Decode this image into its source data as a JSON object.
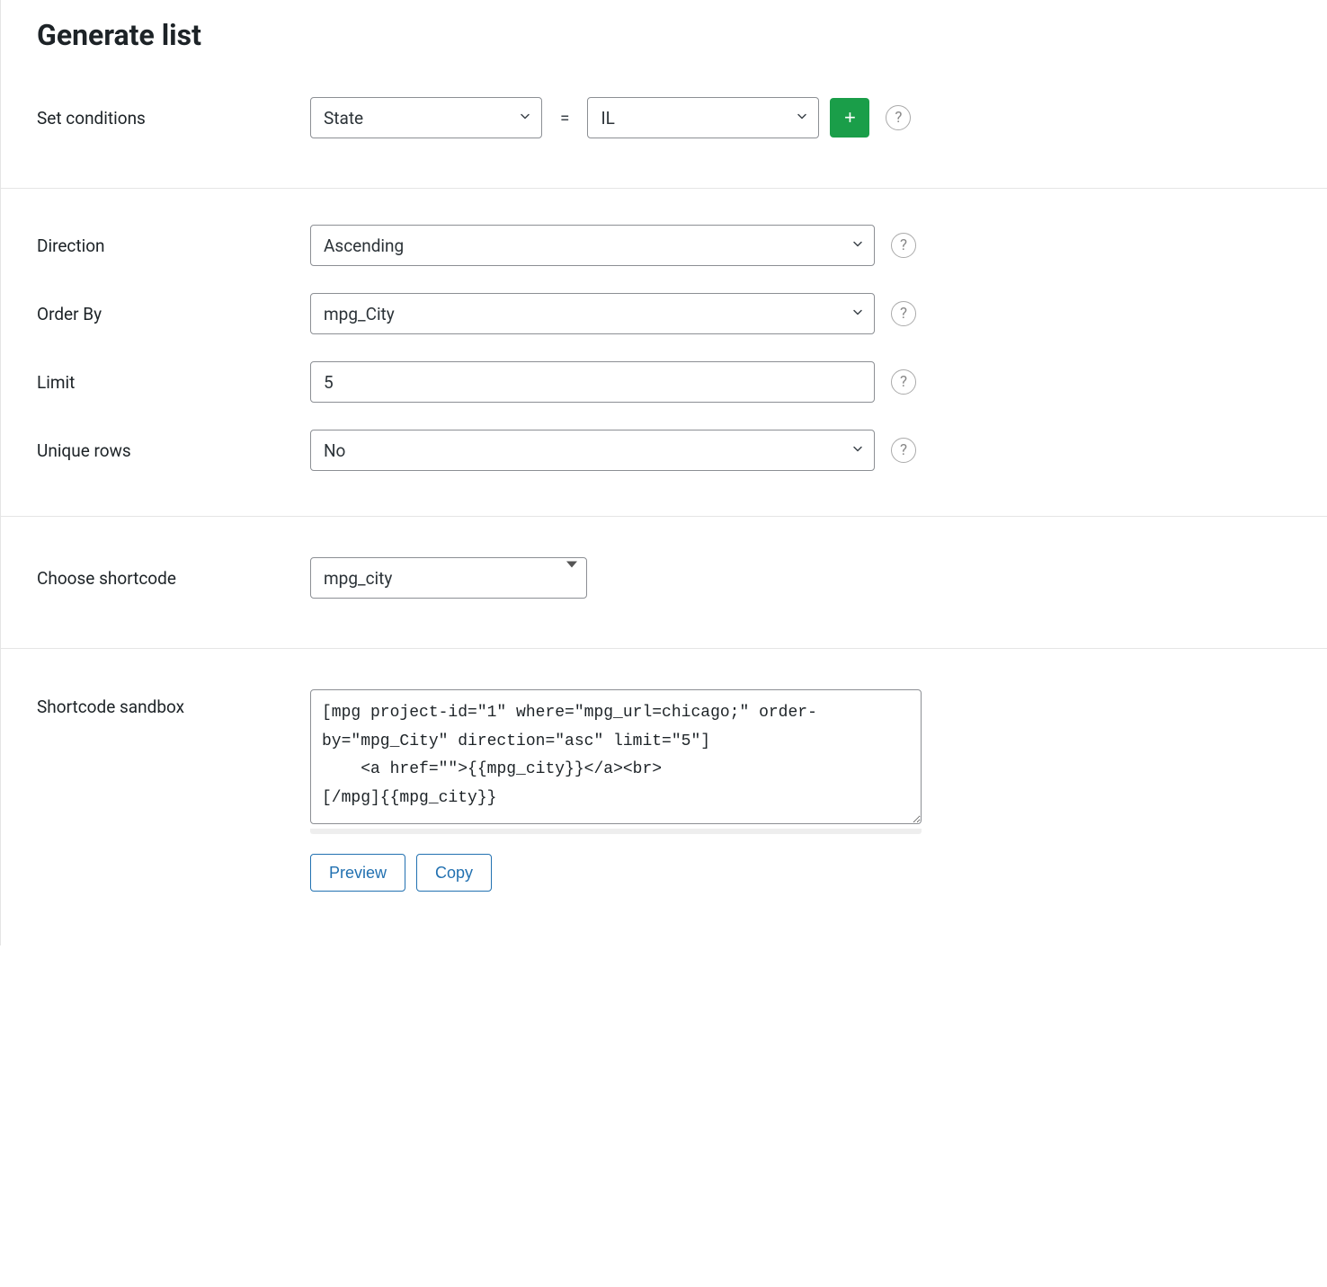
{
  "title": "Generate list",
  "conditions": {
    "label": "Set conditions",
    "field_select": "State",
    "eq": "=",
    "value_select": "IL",
    "add_label": "+"
  },
  "direction": {
    "label": "Direction",
    "value": "Ascending"
  },
  "order_by": {
    "label": "Order By",
    "value": "mpg_City"
  },
  "limit": {
    "label": "Limit",
    "value": "5"
  },
  "unique": {
    "label": "Unique rows",
    "value": "No"
  },
  "shortcode_choose": {
    "label": "Choose shortcode",
    "value": "mpg_city"
  },
  "sandbox": {
    "label": "Shortcode sandbox",
    "value": "[mpg project-id=\"1\" where=\"mpg_url=chicago;\" order-by=\"mpg_City\" direction=\"asc\" limit=\"5\"]\n    <a href=\"\">{{mpg_city}}</a><br>\n[/mpg]{{mpg_city}}",
    "preview_label": "Preview",
    "copy_label": "Copy"
  },
  "help_char": "?"
}
